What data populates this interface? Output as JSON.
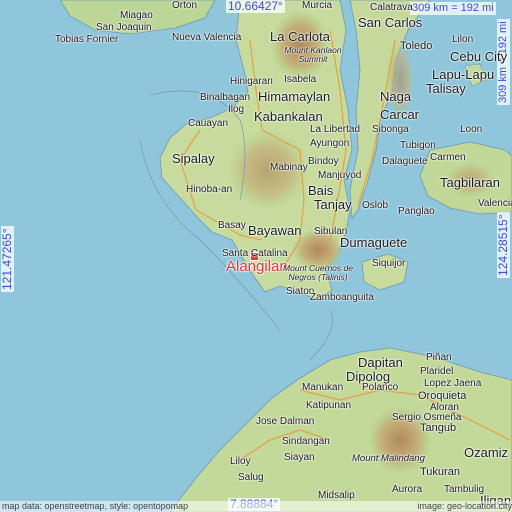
{
  "coords": {
    "top": "10.66427°",
    "bottom": "7.88884°",
    "left": "121.47265°",
    "right": "124.28515°",
    "scale_top": "309 km = 192 mi",
    "scale_right": "309 km = 192 mi"
  },
  "highlight": "Alangilan",
  "labels": {
    "orton": "Orton",
    "murcia": "Murcia",
    "calatrava": "Calatrava",
    "miagao": "Miagao",
    "san_joaquin": "San Joaquin",
    "tobias_fornier": "Tobias Fornier",
    "nueva_valencia": "Nueva Valencia",
    "la_carlota": "La Carlota",
    "san_carlos": "San Carlos",
    "toledo": "Toledo",
    "lilon": "Lilon",
    "cebu_city": "Cebu City",
    "lapu_lapu": "Lapu-Lapu",
    "talisay": "Talisay",
    "mount_kanlaon": "Mount Kanlaon Summit",
    "isabela": "Isabela",
    "hinigaran": "Hinigaran",
    "himamaylan": "Himamaylan",
    "binalbagan": "Binalbagan",
    "ilog": "Ilog",
    "naga": "Naga",
    "carcar": "Carcar",
    "kabankalan": "Kabankalan",
    "cauayan": "Cauayan",
    "la_libertad": "La Libertad",
    "ayungon": "Ayungon",
    "sibonga": "Sibonga",
    "loon": "Loon",
    "tubigon": "Tubigon",
    "sipalay": "Sipalay",
    "mabinay": "Mabinay",
    "bindoy": "Bindoy",
    "dalaguete": "Dalaguete",
    "carmen": "Carmen",
    "manjuyod": "Manjuyod",
    "hinoba_an": "Hinoba-an",
    "bais": "Bais",
    "tagbilaran": "Tagbilaran",
    "tanjay": "Tanjay",
    "oslob": "Oslob",
    "panglao": "Panglao",
    "valencia": "Valencia",
    "basay": "Basay",
    "bayawan": "Bayawan",
    "sibulan": "Sibulan",
    "santa_catalina": "Santa Catalina",
    "dumaguete": "Dumaguete",
    "siquijor": "Siquijor",
    "mount_cuernos": "Mount Cuernos de Negros (Talinis)",
    "siaton": "Siaton",
    "zamboanguita": "Zamboanguita",
    "dapitan": "Dapitan",
    "pinan": "Piñan",
    "dipolog": "Dipolog",
    "polanco": "Polanco",
    "plaridel": "Plaridel",
    "lopez_jaena": "Lopez Jaena",
    "manukan": "Manukan",
    "oroquieta": "Oroquieta",
    "katipunan": "Katipunan",
    "aloran": "Aloran",
    "jose_dalman": "Jose Dalman",
    "sergio_osmena": "Sergio Osmeña",
    "tangub": "Tangub",
    "sindangan": "Sindangan",
    "siayan": "Siayan",
    "ozamiz": "Ozamiz",
    "mount_malindang": "Mount Malindang",
    "liloy": "Liloy",
    "salug": "Salug",
    "tukuran": "Tukuran",
    "aurora": "Aurora",
    "midsalip": "Midsalip",
    "tambulig": "Tambulig",
    "iligan": "Iligan"
  },
  "attribution": "map data: openstreetmap, style: opentopomap",
  "attribution_right": "image: geo-location.city",
  "colors": {
    "sea": "#8fc6dc",
    "land": "#c8dca0",
    "highlight": "#e8343a",
    "coord_text": "#3a4fd0"
  }
}
